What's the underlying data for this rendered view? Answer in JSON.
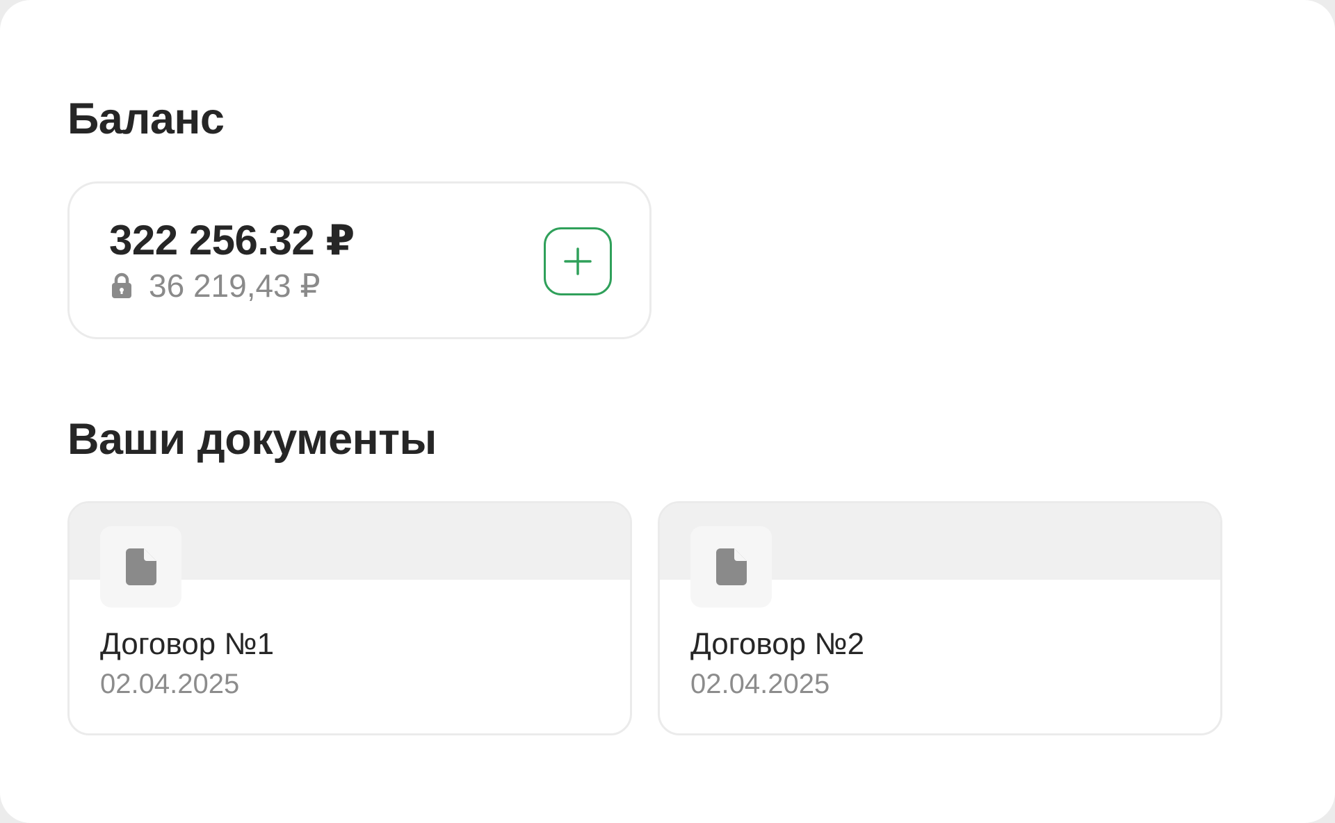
{
  "balance": {
    "title": "Баланс",
    "amount": "322 256.32 ₽",
    "blocked_amount": "36 219,43 ₽",
    "lock_icon": "lock-icon",
    "topup_icon": "plus-icon",
    "accent_color": "#2fa05a"
  },
  "documents": {
    "title": "Ваши документы",
    "items": [
      {
        "name": "Договор №1",
        "date": "02.04.2025",
        "icon": "document-icon"
      },
      {
        "name": "Договор №2",
        "date": "02.04.2025",
        "icon": "document-icon"
      }
    ]
  }
}
